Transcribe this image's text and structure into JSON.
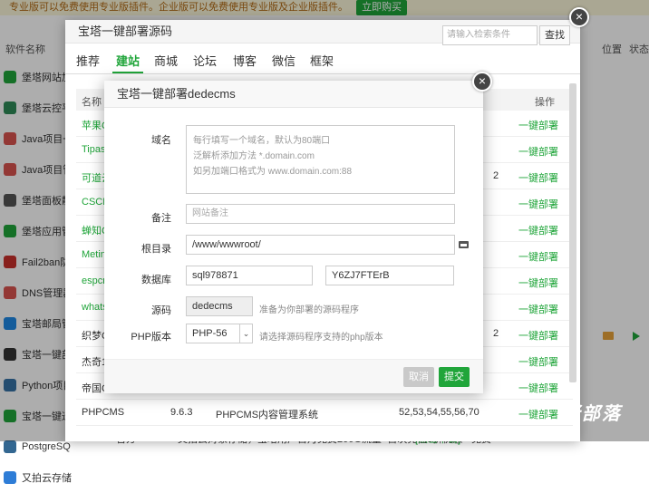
{
  "promo": {
    "text": "专业版可以免费使用专业版插件。企业版可以免费使用专业版及企业版插件。",
    "buy": "立即购买"
  },
  "bg_header": {
    "name": "软件名称",
    "location": "位置",
    "status": "状态"
  },
  "bg_rows": [
    {
      "name": "堡塔网站加",
      "color": "#20a53a",
      "icon": "shield-icon"
    },
    {
      "name": "堡塔云控平",
      "color": "#2e8b57",
      "icon": "tree-icon"
    },
    {
      "name": "Java项目一",
      "color": "#d9534f",
      "icon": "java-icon"
    },
    {
      "name": "Java项目管",
      "color": "#d9534f",
      "icon": "java-icon"
    },
    {
      "name": "堡塔面板静",
      "color": "#555555",
      "icon": "monitor-icon"
    },
    {
      "name": "堡塔应用管",
      "color": "#20a53a",
      "icon": "app-icon"
    },
    {
      "name": "Fail2ban防",
      "color": "#c9302c",
      "icon": "ban-icon"
    },
    {
      "name": "DNS管理器",
      "color": "#d9534f",
      "icon": "dns-icon"
    },
    {
      "name": "宝塔邮局管",
      "color": "#1e88e5",
      "icon": "mail-icon"
    },
    {
      "name": "宝塔一键部",
      "color": "#333333",
      "icon": "code-icon"
    },
    {
      "name": "Python项目",
      "color": "#3572a5",
      "icon": "python-icon"
    },
    {
      "name": "宝塔一键迁",
      "color": "#20a53a",
      "icon": "check-icon"
    },
    {
      "name": "PostgreSQ",
      "color": "#336791",
      "icon": "postgres-icon"
    },
    {
      "name": "又拍云存储",
      "color": "#2e7dd7",
      "icon": "cloud-icon"
    }
  ],
  "bg_bottom": {
    "type": "官方",
    "desc": "又拍云对象存储，宝塔用户首月免费200G流量+首次充值9折优惠",
    "link": "[点击申请]",
    "price": "免费"
  },
  "outer": {
    "title": "宝塔一键部署源码",
    "tabs": [
      "推荐",
      "建站",
      "商城",
      "论坛",
      "博客",
      "微信",
      "框架"
    ],
    "active_tab": "建站",
    "search_placeholder": "请输入检索条件",
    "search_btn": "查找",
    "table_header": {
      "name": "名称",
      "action": "操作"
    },
    "rows": [
      {
        "name": "苹果C",
        "action": "一键部署"
      },
      {
        "name": "Tipas",
        "action": "一键部署"
      },
      {
        "name": "可道云",
        "action": "一键部署",
        "extra": "2"
      },
      {
        "name": "CSCM",
        "action": "一键部署"
      },
      {
        "name": "蝉知C",
        "action": "一键部署"
      },
      {
        "name": "Metin",
        "action": "一键部署"
      },
      {
        "name": "espcm",
        "action": "一键部署"
      },
      {
        "name": "whats",
        "action": "一键部署"
      },
      {
        "name": "织梦C",
        "action": "一键部署",
        "extra": "2"
      },
      {
        "name": "杰奇1.",
        "action": "一键部署"
      },
      {
        "name": "帝国C",
        "action": "一键部署"
      },
      {
        "name": "PHPCMS",
        "version": "9.6.3",
        "desc": "PHPCMS内容管理系统",
        "php": "52,53,54,55,56,70",
        "action": "一键部署"
      }
    ]
  },
  "dialog": {
    "title": "宝塔一键部署dedecms",
    "domain_label": "域名",
    "domain_placeholder_lines": [
      "每行填写一个域名，默认为80端口",
      "泛解析添加方法 *.domain.com",
      "如另加端口格式为 www.domain.com:88"
    ],
    "remark_label": "备注",
    "remark_placeholder": "网站备注",
    "root_label": "根目录",
    "root_value": "/www/wwwroot/",
    "db_label": "数据库",
    "db_user": "sql978871",
    "db_pass": "Y6ZJ7FTErB",
    "source_label": "源码",
    "source_value": "dedecms",
    "source_hint": "准备为你部署的源码程序",
    "php_label": "PHP版本",
    "php_value": "PHP-56",
    "php_hint": "请选择源码程序支持的php版本",
    "cancel": "取消",
    "submit": "提交"
  },
  "watermark": "老部落",
  "colors": {
    "accent": "#20a53a",
    "overlay": "rgba(0,0,0,0.32)"
  }
}
